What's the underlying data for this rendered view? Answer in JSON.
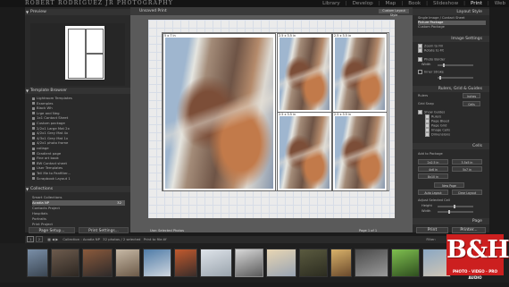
{
  "app": {
    "brand": "ROBERT RODRIGUEZ JR PHOTOGRAPHY",
    "modules": [
      "Library",
      "Develop",
      "Map",
      "Book",
      "Slideshow",
      "Print",
      "Web"
    ],
    "active_module": "Print"
  },
  "left_panel": {
    "preview_header": "Preview",
    "template_header": "Template Browser",
    "templates": [
      {
        "label": "Lightroom Templates"
      },
      {
        "label": "Examples"
      },
      {
        "label": "Black Wh"
      },
      {
        "label": "Lrge and Neg"
      },
      {
        "label": "1x1 Contact Sheet"
      },
      {
        "label": "Custom package"
      },
      {
        "label": "2/2x1 Large Mat 2x"
      },
      {
        "label": "4/2x1 Grey Mat 4x"
      },
      {
        "label": "4/3x1 Grey Mat 1x"
      },
      {
        "label": "4/2x1 photo frame"
      },
      {
        "label": "collage"
      },
      {
        "label": "Gradient page"
      },
      {
        "label": "Fine art book"
      },
      {
        "label": "BW Contact sheet"
      },
      {
        "label": "User Templates"
      },
      {
        "label": "Tell Me to Panfilter..."
      },
      {
        "label": "Scrapbook Layout 1"
      }
    ],
    "collections_header": "Collections",
    "collections": [
      {
        "label": "Smart Collections",
        "count": ""
      },
      {
        "label": "Acadia NP",
        "count": "32",
        "selected": true
      },
      {
        "label": "Contacts Project",
        "count": ""
      },
      {
        "label": "Hospitals",
        "count": ""
      },
      {
        "label": "Portraits",
        "count": ""
      },
      {
        "label": "Print Project",
        "count": ""
      }
    ],
    "page_setup_btn": "Page Setup...",
    "print_settings_btn": "Print Settings..."
  },
  "center": {
    "tab_label": "Unsaved Print",
    "auto_size_label": "Custom Layout Style",
    "cell_tags": [
      "5 x 7 in",
      "2.5 x 3.5 in",
      "2.5 x 3.5 in",
      "2.5 x 3.5 in",
      "2.5 x 3.5 in"
    ],
    "use_label": "Use:",
    "use_value": "Selected Photos",
    "page_count": "Page 1 of 1"
  },
  "right_panel": {
    "layout_style_header": "Layout Style",
    "layout_options": [
      "Single Image / Contact Sheet",
      "Picture Package",
      "Custom Package"
    ],
    "image_settings_header": "Image Settings",
    "image_settings": [
      "Zoom to Fill",
      "Rotate to Fit",
      "Photo Border",
      "Inner Stroke"
    ],
    "width_label": "Width",
    "rulers_header": "Rulers, Grid & Guides",
    "rulers_label": "Rulers",
    "rulers_value": "Inches",
    "grid_label": "Grid Snap",
    "grid_value": "Cells",
    "show_guides": [
      "Show Guides",
      "Rulers",
      "Page Bleed",
      "Page Grid",
      "Image Cells",
      "Dimensions"
    ],
    "cells_header": "Cells",
    "add_to_package_label": "Add to Package",
    "cell_sizes": [
      "2x2.5 in",
      "3.5x5 in",
      "4x6 in",
      "5x7 in",
      "8x10 in"
    ],
    "new_page_btn": "New Page",
    "auto_layout_btn": "Auto Layout",
    "clear_layout_btn": "Clear Layout",
    "adjust_label": "Adjust Selected Cell",
    "height_label": "Height",
    "page_header": "Page",
    "print_btn": "Print",
    "printer_btn": "Printer..."
  },
  "filmstrip": {
    "pages": [
      "1",
      "2"
    ],
    "collection_label": "Collection : Acadia NP",
    "count_label": "32 photos / 2 selected",
    "filename_label": "Print to file.tif",
    "filter_label": "Filter:"
  },
  "logo": {
    "text": "B&H",
    "sub": "PHOTO · VIDEO · PRO AUDIO"
  },
  "colors": {
    "background": "#1b1b1b",
    "panel": "#2a2a2a",
    "logo_red": "#cc1f1f"
  }
}
